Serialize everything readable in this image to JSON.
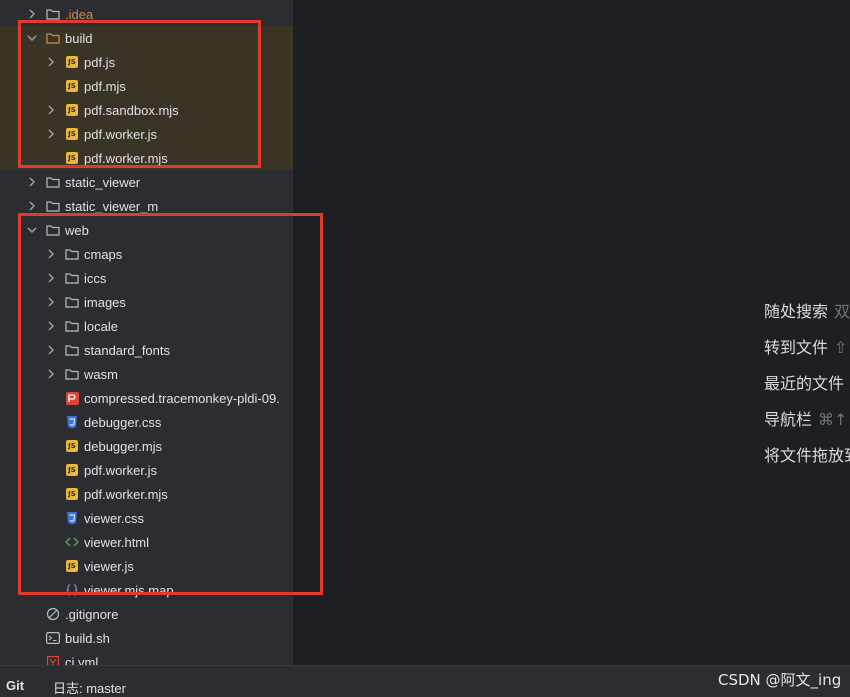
{
  "tree": [
    {
      "label": ".idea",
      "kind": "folder",
      "expanded": false,
      "depth": 0,
      "dim": true
    },
    {
      "label": "build",
      "kind": "folder-orange",
      "expanded": true,
      "depth": 0
    },
    {
      "label": "pdf.js",
      "kind": "js",
      "expandable": true,
      "depth": 1
    },
    {
      "label": "pdf.mjs",
      "kind": "js",
      "expandable": false,
      "depth": 1
    },
    {
      "label": "pdf.sandbox.mjs",
      "kind": "js",
      "expandable": true,
      "depth": 1
    },
    {
      "label": "pdf.worker.js",
      "kind": "js",
      "expandable": true,
      "depth": 1
    },
    {
      "label": "pdf.worker.mjs",
      "kind": "js",
      "expandable": false,
      "depth": 1
    },
    {
      "label": "static_viewer",
      "kind": "folder",
      "expanded": false,
      "depth": 0
    },
    {
      "label": "static_viewer_m",
      "kind": "folder",
      "expanded": false,
      "depth": 0
    },
    {
      "label": "web",
      "kind": "folder",
      "expanded": true,
      "depth": 0
    },
    {
      "label": "cmaps",
      "kind": "folder",
      "expanded": false,
      "depth": 1
    },
    {
      "label": "iccs",
      "kind": "folder",
      "expanded": false,
      "depth": 1
    },
    {
      "label": "images",
      "kind": "folder",
      "expanded": false,
      "depth": 1
    },
    {
      "label": "locale",
      "kind": "folder",
      "expanded": false,
      "depth": 1
    },
    {
      "label": "standard_fonts",
      "kind": "folder",
      "expanded": false,
      "depth": 1
    },
    {
      "label": "wasm",
      "kind": "folder",
      "expanded": false,
      "depth": 1
    },
    {
      "label": "compressed.tracemonkey-pldi-09.",
      "kind": "pdf",
      "expandable": false,
      "depth": 1
    },
    {
      "label": "debugger.css",
      "kind": "css",
      "expandable": false,
      "depth": 1
    },
    {
      "label": "debugger.mjs",
      "kind": "js",
      "expandable": false,
      "depth": 1
    },
    {
      "label": "pdf.worker.js",
      "kind": "js",
      "expandable": false,
      "depth": 1
    },
    {
      "label": "pdf.worker.mjs",
      "kind": "js",
      "expandable": false,
      "depth": 1
    },
    {
      "label": "viewer.css",
      "kind": "css",
      "expandable": false,
      "depth": 1
    },
    {
      "label": "viewer.html",
      "kind": "html",
      "expandable": false,
      "depth": 1
    },
    {
      "label": "viewer.js",
      "kind": "js",
      "expandable": false,
      "depth": 1
    },
    {
      "label": "viewer.mjs.map",
      "kind": "map",
      "expandable": false,
      "depth": 1
    },
    {
      "label": ".gitignore",
      "kind": "ignore",
      "expandable": false,
      "depth": 0
    },
    {
      "label": "build.sh",
      "kind": "shell",
      "expandable": false,
      "depth": 0
    },
    {
      "label": "ci.yml",
      "kind": "yaml",
      "expandable": false,
      "depth": 0
    }
  ],
  "hints": [
    {
      "label": "随处搜索",
      "shortcut": "双"
    },
    {
      "label": "转到文件",
      "shortcut": "⇧"
    },
    {
      "label": "最近的文件",
      "shortcut": ""
    },
    {
      "label": "导航栏",
      "shortcut": "⌘↑"
    },
    {
      "label": "将文件拖放到",
      "shortcut": ""
    }
  ],
  "statusbar": {
    "git": "Git",
    "log": "日志: master"
  },
  "watermark": "CSDN @阿文_ing",
  "colors": {
    "highlight": "#3a3426",
    "annotation": "#e23b2e",
    "js": "#e8b73a",
    "css": "#3d6fe0",
    "pdf": "#d8443a"
  }
}
